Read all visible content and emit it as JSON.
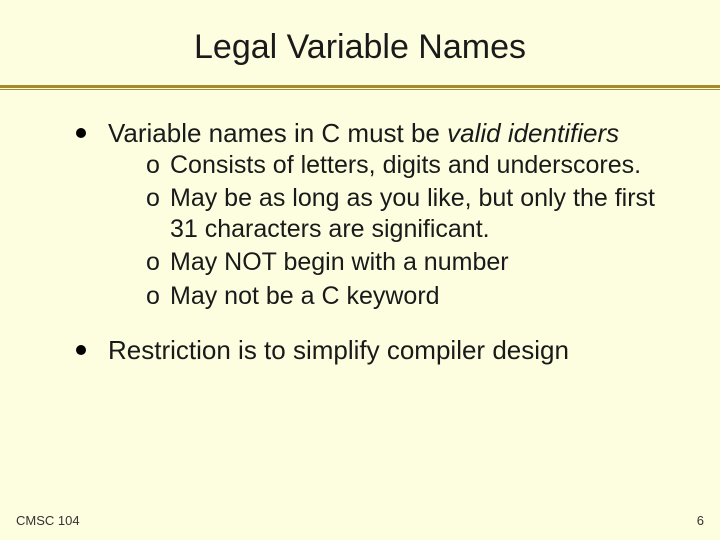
{
  "slide": {
    "title": "Legal Variable Names",
    "bullets": [
      {
        "text_plain": "Variable names in C must be ",
        "text_italic": "valid identifiers",
        "sub": [
          "Consists of letters, digits and  underscores.",
          "May be as long as you like, but only the first 31 characters are significant.",
          "May NOT begin with a number",
          "May not be a C keyword"
        ]
      },
      {
        "text_plain": "Restriction is to simplify compiler design",
        "text_italic": "",
        "sub": []
      }
    ],
    "footer_left": "CMSC 104",
    "footer_right": "6",
    "sub_marker": "o"
  }
}
